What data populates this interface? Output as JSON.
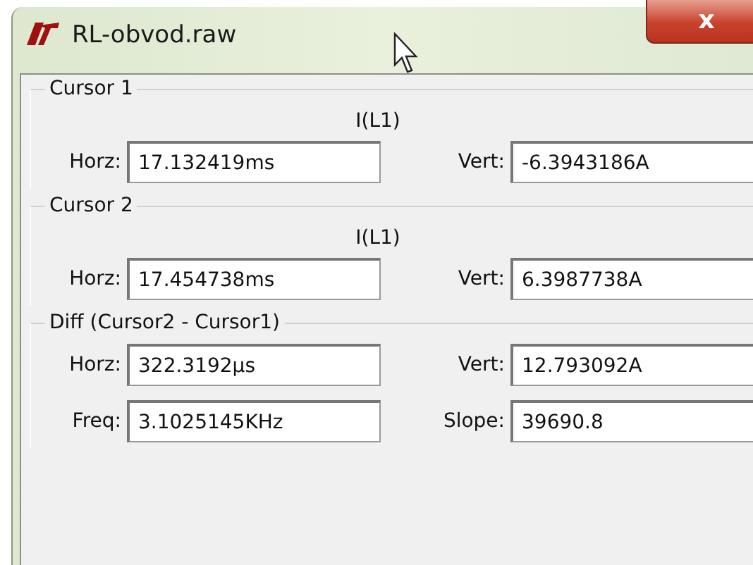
{
  "window": {
    "title": "RL-obvod.raw",
    "close": "x"
  },
  "groups": [
    {
      "title": "Cursor 1",
      "signal": "I(L1)",
      "fields": [
        {
          "label": "Horz:",
          "value": "17.132419ms"
        },
        {
          "label": "Vert:",
          "value": "-6.3943186A"
        }
      ]
    },
    {
      "title": "Cursor 2",
      "signal": "I(L1)",
      "fields": [
        {
          "label": "Horz:",
          "value": "17.454738ms"
        },
        {
          "label": "Vert:",
          "value": "6.3987738A"
        }
      ]
    },
    {
      "title": "Diff (Cursor2 - Cursor1)",
      "fields": [
        {
          "label": "Horz:",
          "value": "322.3192µs"
        },
        {
          "label": "Vert:",
          "value": "12.793092A"
        },
        {
          "label": "Freq:",
          "value": "3.1025145KHz"
        },
        {
          "label": "Slope:",
          "value": "39690.8"
        }
      ]
    }
  ]
}
